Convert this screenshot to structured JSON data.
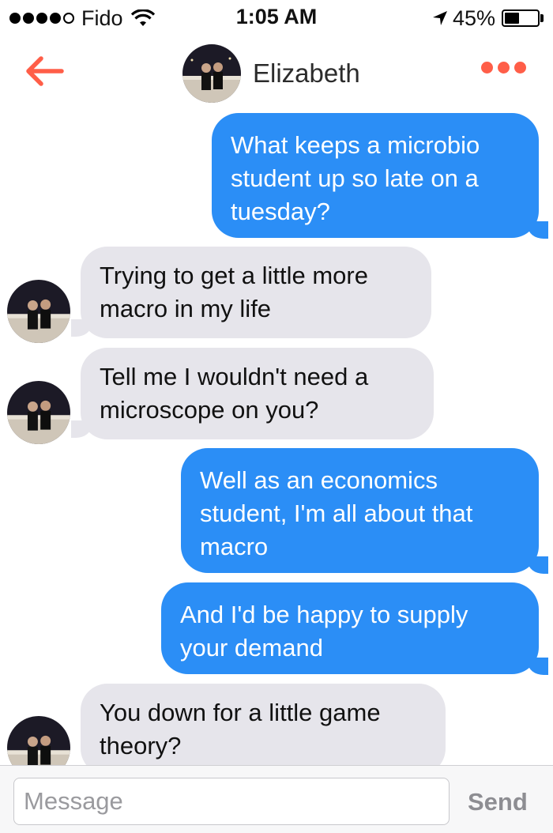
{
  "status_bar": {
    "carrier": "Fido",
    "signal_bars_filled": 4,
    "signal_bars_total": 5,
    "time": "1:05 AM",
    "battery_percent_label": "45%",
    "battery_level": 0.45
  },
  "nav": {
    "back_icon": "arrow-left-icon",
    "title": "Elizabeth",
    "more_icon": "three-dots-icon",
    "accent_color": "#ff5e48"
  },
  "messages": [
    {
      "direction": "outgoing",
      "text": "What keeps a microbio student up so late on a tuesday?"
    },
    {
      "direction": "incoming",
      "text": "Trying to get a little more macro in my life"
    },
    {
      "direction": "incoming",
      "text": "Tell me I wouldn't need a microscope on you?"
    },
    {
      "direction": "outgoing",
      "text": "Well as an economics student, I'm all about that macro"
    },
    {
      "direction": "outgoing",
      "text": "And I'd be happy to supply your demand"
    },
    {
      "direction": "incoming",
      "text": "You down for a little game theory?"
    }
  ],
  "colors": {
    "outgoing_bubble": "#2b8ef6",
    "incoming_bubble": "#e6e5eb"
  },
  "composer": {
    "placeholder": "Message",
    "send_label": "Send"
  }
}
